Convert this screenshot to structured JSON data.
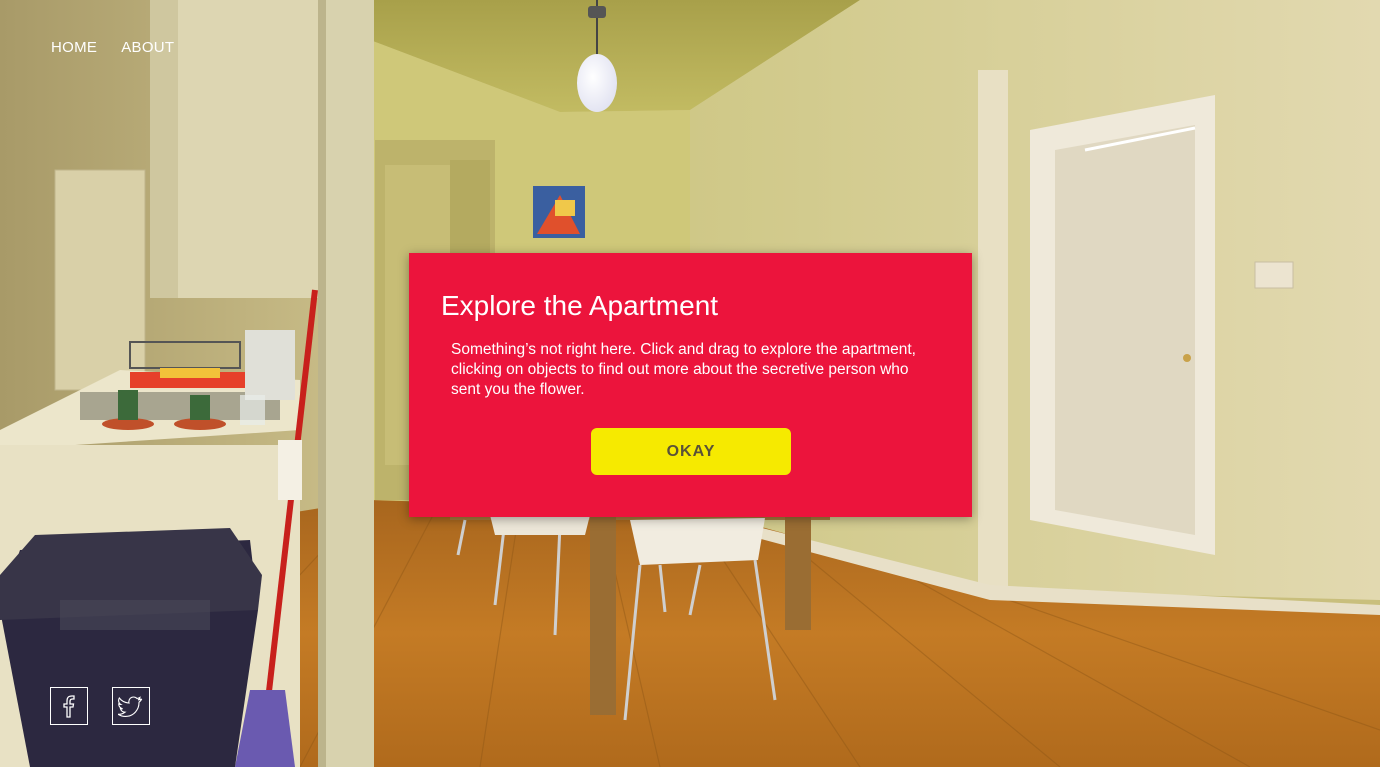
{
  "nav": {
    "home_label": "HOME",
    "about_label": "ABOUT"
  },
  "modal": {
    "title": "Explore the Apartment",
    "body": "Something’s not right here. Click and drag to explore the apartment, clicking on objects to find out more about the secretive person who sent you the flower.",
    "okay_label": "OKAY"
  },
  "social": {
    "items": [
      {
        "icon": "facebook-icon"
      },
      {
        "icon": "twitter-icon"
      }
    ]
  },
  "colors": {
    "modal_bg": "#ec143c",
    "button_bg": "#f6ea00",
    "button_text": "#5a5238",
    "nav_text": "#ffffff"
  }
}
